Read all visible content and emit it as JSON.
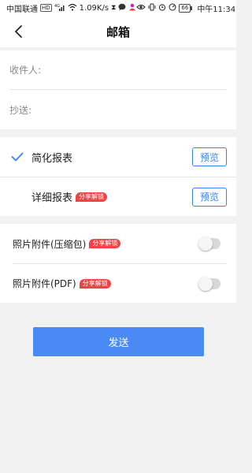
{
  "status_bar": {
    "carrier": "中国联通",
    "hd_tag": "HD",
    "signal": "4G",
    "speed": "1.09K/s",
    "battery": "66",
    "time": "中午11:34"
  },
  "header": {
    "title": "邮箱"
  },
  "recipients": {
    "to_label": "收件人:",
    "to_value": "",
    "cc_label": "抄送:",
    "cc_value": ""
  },
  "reports": [
    {
      "label": "简化报表",
      "checked": true,
      "badge": "",
      "preview_label": "预览"
    },
    {
      "label": "详细报表",
      "checked": false,
      "badge": "分享解锁",
      "preview_label": "预览"
    }
  ],
  "attachments": [
    {
      "label": "照片附件(压缩包)",
      "badge": "分享解锁",
      "enabled": false
    },
    {
      "label": "照片附件(PDF)",
      "badge": "分享解锁",
      "enabled": false
    }
  ],
  "send_button": {
    "label": "发送"
  },
  "colors": {
    "accent": "#4a8af4",
    "preview_border": "#3b82f6",
    "badge": "#ef4444",
    "background": "#f2f2f2"
  }
}
